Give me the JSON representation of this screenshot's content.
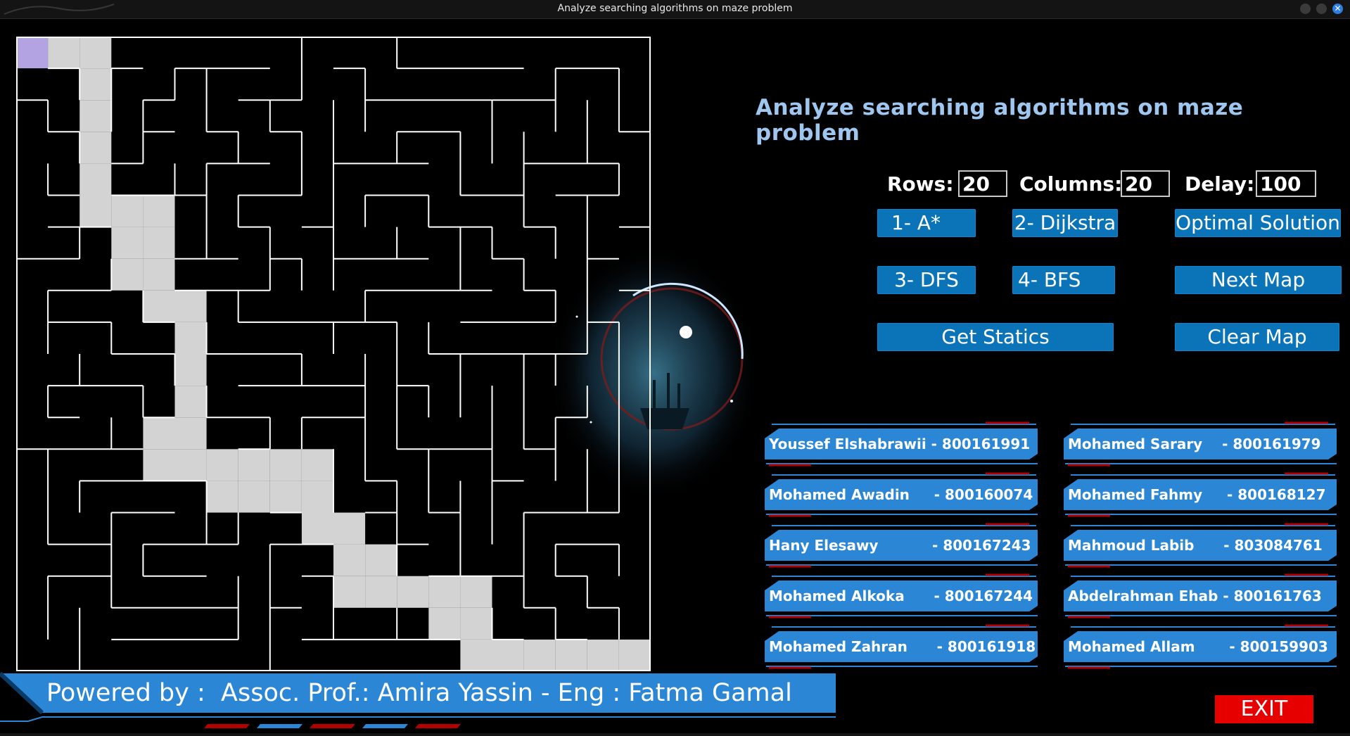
{
  "window": {
    "title": "Analyze searching algorithms on maze problem"
  },
  "heading": "Analyze searching algorithms on maze problem",
  "params": {
    "rows_label": "Rows:",
    "rows_value": "20",
    "columns_label": "Columns:",
    "columns_value": "20",
    "delay_label": "Delay:",
    "delay_value": "100"
  },
  "buttons": {
    "astar": "1- A*",
    "dijkstra": "2- Dijkstra",
    "optimal": "Optimal Solution",
    "dfs": "3- DFS",
    "bfs": "4- BFS",
    "next_map": "Next Map",
    "get_statics": "Get Statics",
    "clear_map": "Clear Map",
    "exit": "EXIT"
  },
  "team": [
    "Youssef Elshabrawii - 800161991",
    "Mohamed Sarary    - 800161979",
    "Mohamed Awadin     - 800160074",
    "Mohamed Fahmy     - 800168127",
    "Hany Elesawy           - 800167243",
    "Mahmoud Labib      - 803084761",
    "Mohamed Alkoka      - 800167244",
    "Abdelrahman Ehab - 800161763",
    "Mohamed Zahran      - 800161918",
    "Mohamed Allam       - 800159903"
  ],
  "footer": "Powered by :  Assoc. Prof.: Amira Yassin - Eng : Fatma Gamal",
  "maze": {
    "rows": 20,
    "cols": 20,
    "start_color": "#b3a3e3",
    "path_color": "#d3d3d3",
    "wall_color": "#ffffff",
    "start_cell": [
      0,
      0
    ],
    "solution_path": [
      [
        0,
        1
      ],
      [
        0,
        2
      ],
      [
        1,
        2
      ],
      [
        2,
        2
      ],
      [
        3,
        2
      ],
      [
        4,
        2
      ],
      [
        5,
        2
      ],
      [
        5,
        3
      ],
      [
        5,
        4
      ],
      [
        6,
        3
      ],
      [
        6,
        4
      ],
      [
        7,
        3
      ],
      [
        7,
        4
      ],
      [
        8,
        4
      ],
      [
        8,
        5
      ],
      [
        9,
        5
      ],
      [
        10,
        5
      ],
      [
        11,
        5
      ],
      [
        12,
        4
      ],
      [
        12,
        5
      ],
      [
        13,
        4
      ],
      [
        13,
        5
      ],
      [
        13,
        6
      ],
      [
        13,
        7
      ],
      [
        13,
        8
      ],
      [
        13,
        9
      ],
      [
        14,
        6
      ],
      [
        14,
        7
      ],
      [
        14,
        8
      ],
      [
        14,
        9
      ],
      [
        15,
        9
      ],
      [
        15,
        10
      ],
      [
        16,
        10
      ],
      [
        16,
        11
      ],
      [
        17,
        10
      ],
      [
        17,
        11
      ],
      [
        17,
        12
      ],
      [
        17,
        13
      ],
      [
        17,
        14
      ],
      [
        18,
        13
      ],
      [
        18,
        14
      ],
      [
        19,
        14
      ],
      [
        19,
        15
      ],
      [
        19,
        16
      ],
      [
        19,
        17
      ],
      [
        19,
        18
      ],
      [
        19,
        19
      ]
    ]
  },
  "colors": {
    "accent_blue": "#0b74b8",
    "heading_blue": "#9fc6ee",
    "exit_red": "#e60000",
    "badge_blue": "#2b86d6"
  }
}
